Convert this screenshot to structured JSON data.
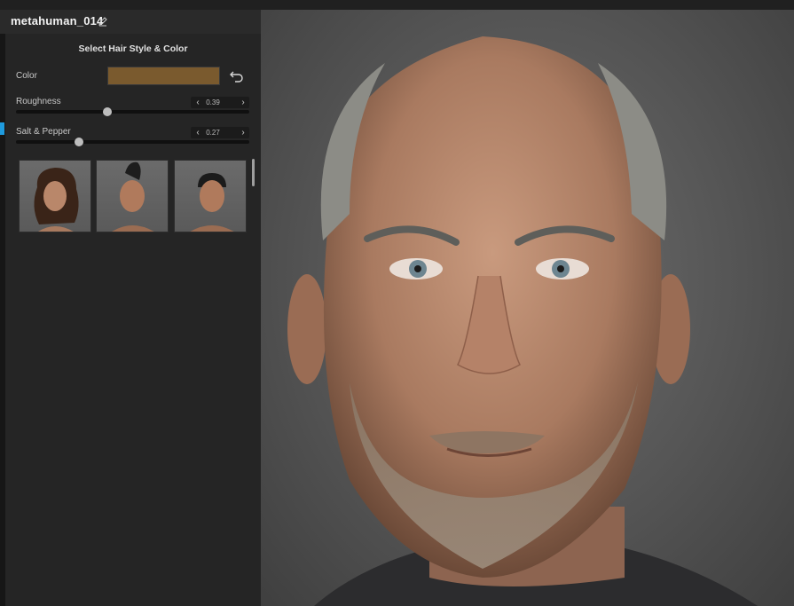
{
  "window": {
    "title": "metahuman_014",
    "edit_icon": "pencil-icon"
  },
  "panel": {
    "title": "Select Hair Style & Color",
    "color": {
      "label": "Color",
      "swatch_hex": "#7a5a2e",
      "reset_icon": "undo-arrow-icon"
    },
    "roughness": {
      "label": "Roughness",
      "value": "0.39",
      "level": 0.39
    },
    "salt_pepper": {
      "label": "Salt & Pepper",
      "value": "0.27",
      "level": 0.27
    },
    "hair_styles": [
      {
        "name": "long-curly-hair"
      },
      {
        "name": "mohawk-hair"
      },
      {
        "name": "short-cropped-hair"
      }
    ]
  },
  "colors": {
    "accent": "#1f9bde",
    "panel_bg": "#252525",
    "viewport_bg": "#5a5a5a"
  }
}
